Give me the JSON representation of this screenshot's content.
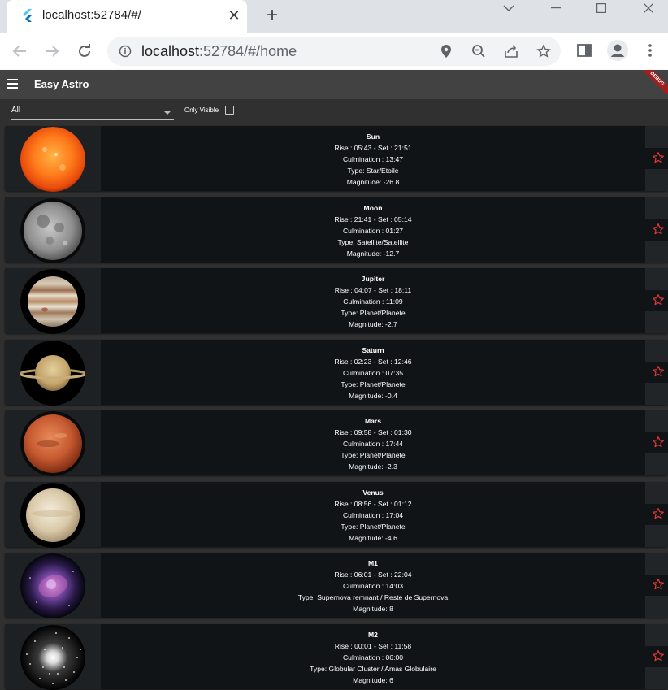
{
  "browser": {
    "tab_title": "localhost:52784/#/",
    "url_host": "localhost",
    "url_rest": ":52784/#/home"
  },
  "app": {
    "title": "Easy Astro",
    "debug_banner": "DEBUG",
    "filter_value": "All",
    "only_visible_label": "Only Visible"
  },
  "objects": [
    {
      "name": "Sun",
      "rise_set": "Rise : 05:43 - Set : 21:51",
      "culmination": "Culmination : 13:47",
      "type": "Type: Star/Etoile",
      "magnitude": "Magnitude: -26.8",
      "image": "sun"
    },
    {
      "name": "Moon",
      "rise_set": "Rise : 21:41 - Set : 05:14",
      "culmination": "Culmination : 01:27",
      "type": "Type: Satellite/Satellite",
      "magnitude": "Magnitude: -12.7",
      "image": "moon"
    },
    {
      "name": "Jupiter",
      "rise_set": "Rise : 04:07 - Set : 18:11",
      "culmination": "Culmination : 11:09",
      "type": "Type: Planet/Planete",
      "magnitude": "Magnitude: -2.7",
      "image": "jupiter"
    },
    {
      "name": "Saturn",
      "rise_set": "Rise : 02:23 - Set : 12:46",
      "culmination": "Culmination : 07:35",
      "type": "Type: Planet/Planete",
      "magnitude": "Magnitude: -0.4",
      "image": "saturn"
    },
    {
      "name": "Mars",
      "rise_set": "Rise : 09:58 - Set : 01:30",
      "culmination": "Culmination : 17:44",
      "type": "Type: Planet/Planete",
      "magnitude": "Magnitude: -2.3",
      "image": "mars"
    },
    {
      "name": "Venus",
      "rise_set": "Rise : 08:56 - Set : 01:12",
      "culmination": "Culmination : 17:04",
      "type": "Type: Planet/Planete",
      "magnitude": "Magnitude: -4.6",
      "image": "venus"
    },
    {
      "name": "M1",
      "rise_set": "Rise : 06:01 - Set : 22:04",
      "culmination": "Culmination : 14:03",
      "type": "Type: Supernova remnant / Reste de Supernova",
      "magnitude": "Magnitude: 8",
      "image": "nebula"
    },
    {
      "name": "M2",
      "rise_set": "Rise : 00:01 - Set : 11:58",
      "culmination": "Culmination : 06:00",
      "type": "Type: Globular Cluster / Amas Globulaire",
      "magnitude": "Magnitude: 6",
      "image": "cluster"
    }
  ],
  "colors": {
    "appbar": "#424242",
    "card": "#111417",
    "star": "#e53935"
  }
}
